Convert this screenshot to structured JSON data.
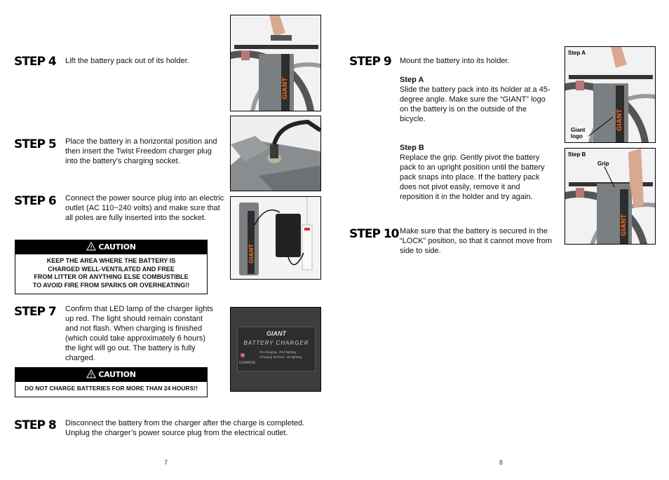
{
  "pages": [
    {
      "page_number": "7",
      "steps": [
        {
          "title": "STEP 4",
          "text": "Lift the battery pack out of its holder."
        },
        {
          "title": "STEP 5",
          "text": "Place the battery in a horizontal position and then insert the Twist Freedom charger plug into the battery’s charging socket."
        },
        {
          "title": "STEP 6",
          "text": "Connect the power source plug into an electric outlet (AC 110~240 volts) and make sure that all poles are fully inserted into the socket."
        },
        {
          "title": "STEP 7",
          "text": "Confirm that LED lamp of the charger lights up red.  The light should remain constant and not flash.  When charging is finished (which could take approximately 6 hours) the light will go out.  The battery is fully charged."
        },
        {
          "title": "STEP 8",
          "text": "Disconnect the battery from the charger after the charge is completed. Unplug the charger’s power source plug from the electrical outlet."
        }
      ],
      "cautions": [
        {
          "heading": "CAUTION",
          "lines": [
            "KEEP THE AREA WHERE THE BATTERY IS",
            "CHARGED WELL-VENTILATED AND FREE",
            "FROM LITTER OR ANYTHING ELSE COMBUSTIBLE",
            "TO AVOID FIRE FROM SPARKS OR OVERHEATING!!"
          ]
        },
        {
          "heading": "CAUTION",
          "lines": [
            "DO NOT CHARGE BATTERIES FOR MORE THAN 24 HOURS!!"
          ]
        }
      ],
      "photos": {
        "charger_panel": {
          "brand": "GIANT",
          "title": "BATTERY CHARGER",
          "legend_1": "On charging : Red lighting",
          "legend_2": "Charging finished : No lighting",
          "led_label": "CHARGE"
        },
        "battery_brand": "GIANT"
      }
    },
    {
      "page_number": "8",
      "steps": [
        {
          "title": "STEP 9",
          "text": "Mount the battery into its holder.",
          "substeps": [
            {
              "title": "Step A",
              "text": "Slide the battery pack into its holder at a 45-degree angle.  Make sure the “GIANT” logo on the battery is on the outside of the bicycle."
            },
            {
              "title": "Step B",
              "text": "Replace the grip.  Gently pivot the battery pack to an upright position until the battery pack snaps into place.  If the battery pack does not pivot easily, remove it and reposition it in the holder and try again."
            }
          ]
        },
        {
          "title": "STEP 10",
          "text": "Make sure that the battery is secured in the “LOCK” position, so that it cannot move from side to side."
        }
      ],
      "photos": {
        "step_a": {
          "label": "Step A",
          "callout": "Giant logo"
        },
        "step_b": {
          "label": "Step B",
          "callout": "Grip"
        }
      }
    }
  ],
  "colors": {
    "brand_orange": "#e8641e",
    "battery_gray": "#7a7d80",
    "caution_black": "#000000"
  }
}
